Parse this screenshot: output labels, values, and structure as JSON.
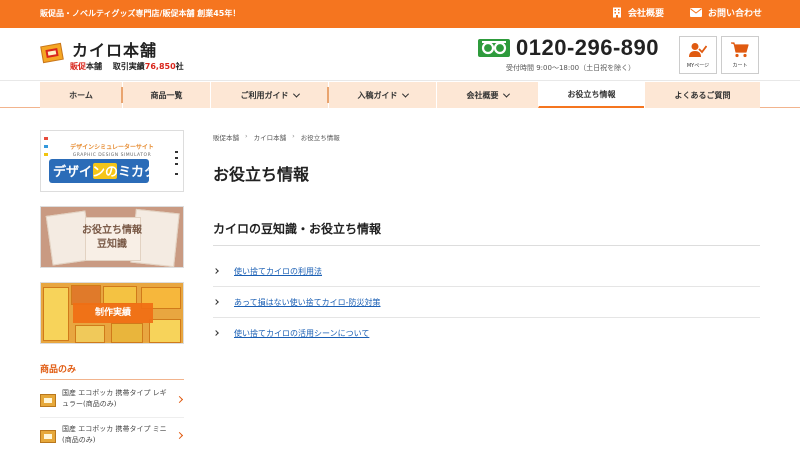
{
  "topbar": {
    "tagline": "販促品・ノベルティグッズ専門店/販促本舗 創業45年！",
    "company_label": "会社概要",
    "contact_label": "お問い合わせ"
  },
  "header": {
    "logo_main": "カイロ本舗",
    "logo_brand": "販促",
    "logo_brand2": "本舗",
    "record_prefix": "取引実績",
    "record_num": "76,850",
    "record_suffix": "社",
    "phone": "0120-296-890",
    "hours": "受付時間 9:00～18:00（土日祝を除く）",
    "mypage_label": "MYページ",
    "cart_label": "カート"
  },
  "nav": {
    "items": [
      {
        "label": "ホーム"
      },
      {
        "label": "商品一覧"
      },
      {
        "label": "ご利用ガイド"
      },
      {
        "label": "入稿ガイド"
      },
      {
        "label": "会社概要"
      },
      {
        "label": "お役立ち情報"
      },
      {
        "label": "よくあるご質問"
      }
    ]
  },
  "sidebar": {
    "design_banner": {
      "top_text": "デザインシミュレーターサイト",
      "sub_text": "GRAPHIC DESIGN SIMULATOR",
      "main_text": "デザインのミカタ"
    },
    "useful_banner": {
      "line1": "お役立ち情報",
      "line2": "豆知識"
    },
    "works_banner": {
      "label": "制作実績"
    },
    "heading": "商品のみ",
    "items": [
      {
        "text": "国産 エコポッカ 携帯タイプ レギュラー(商品のみ)"
      },
      {
        "text": "国産 エコポッカ 携帯タイプ ミニ (商品のみ)"
      }
    ]
  },
  "breadcrumb": {
    "items": [
      {
        "label": "販促本舗"
      },
      {
        "label": "カイロ本舗"
      },
      {
        "label": "お役立ち情報"
      }
    ],
    "separator": "›"
  },
  "main": {
    "title": "お役立ち情報",
    "section_title": "カイロの豆知識・お役立ち情報",
    "links": [
      {
        "label": "使い捨てカイロの利用法"
      },
      {
        "label": "あって損はない使い捨てカイロ-防災対策"
      },
      {
        "label": "使い捨てカイロの活用シーンについて"
      }
    ]
  },
  "colors": {
    "accent": "#f5751f",
    "nav_bg": "#fde7d5",
    "link": "#1a5fb4",
    "brand_red": "#d9261c"
  }
}
